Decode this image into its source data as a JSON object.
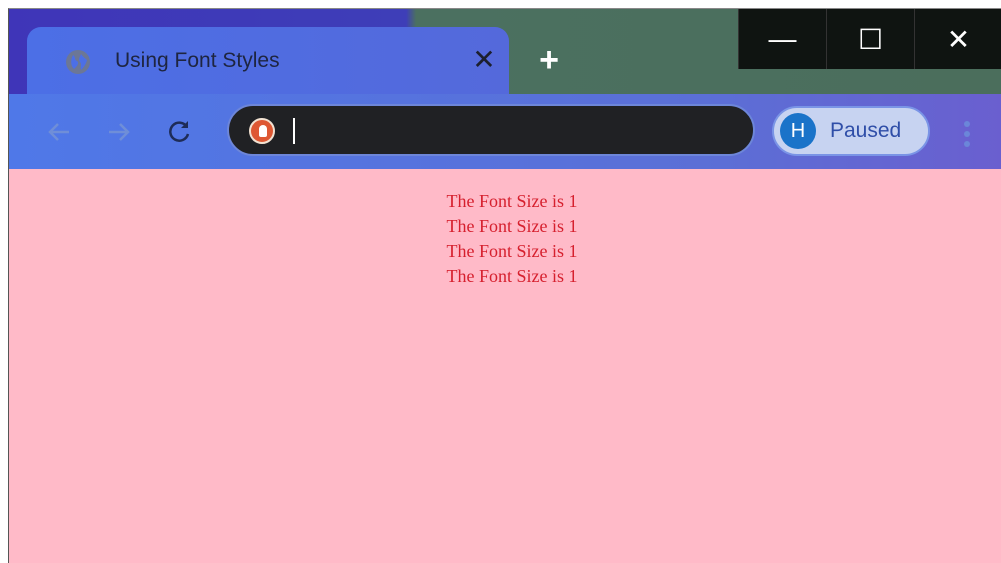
{
  "tab": {
    "title": "Using Font Styles",
    "close_label": "✕",
    "icon": "globe-icon"
  },
  "new_tab_label": "+",
  "window_controls": {
    "minimize": "—",
    "maximize": "☐",
    "close": "✕"
  },
  "toolbar": {
    "back_icon": "back-arrow-icon",
    "forward_icon": "forward-arrow-icon",
    "reload_icon": "reload-icon",
    "address_value": "",
    "search_engine_icon": "duckduckgo-icon",
    "profile_initial": "H",
    "profile_status": "Paused",
    "menu_icon": "more-vert-icon"
  },
  "page": {
    "lines": [
      "The Font Size is 1",
      "The Font Size is 1",
      "The Font Size is 1",
      "The Font Size is 1"
    ],
    "background": "#ffbac8",
    "text_color": "#d6202e"
  },
  "colors": {
    "tab_strip": "#4b6e5c",
    "active_tab": "#4c6fe6",
    "omnibox": "#202124",
    "profile_chip": "#c7d3f1",
    "avatar": "#1a73c9"
  }
}
